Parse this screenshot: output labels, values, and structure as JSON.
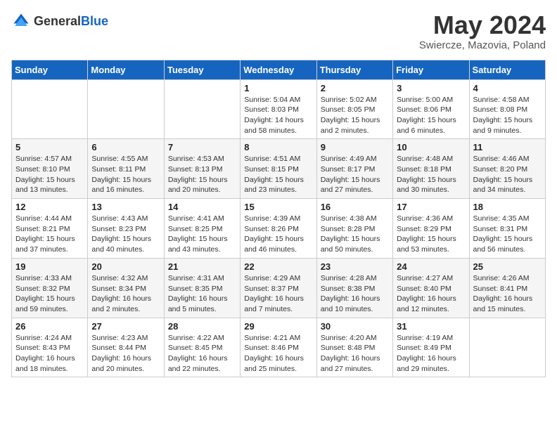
{
  "header": {
    "logo_general": "General",
    "logo_blue": "Blue",
    "month": "May 2024",
    "location": "Swiercze, Mazovia, Poland"
  },
  "weekdays": [
    "Sunday",
    "Monday",
    "Tuesday",
    "Wednesday",
    "Thursday",
    "Friday",
    "Saturday"
  ],
  "weeks": [
    [
      {
        "day": "",
        "sunrise": "",
        "sunset": "",
        "daylight": ""
      },
      {
        "day": "",
        "sunrise": "",
        "sunset": "",
        "daylight": ""
      },
      {
        "day": "",
        "sunrise": "",
        "sunset": "",
        "daylight": ""
      },
      {
        "day": "1",
        "sunrise": "Sunrise: 5:04 AM",
        "sunset": "Sunset: 8:03 PM",
        "daylight": "Daylight: 14 hours and 58 minutes."
      },
      {
        "day": "2",
        "sunrise": "Sunrise: 5:02 AM",
        "sunset": "Sunset: 8:05 PM",
        "daylight": "Daylight: 15 hours and 2 minutes."
      },
      {
        "day": "3",
        "sunrise": "Sunrise: 5:00 AM",
        "sunset": "Sunset: 8:06 PM",
        "daylight": "Daylight: 15 hours and 6 minutes."
      },
      {
        "day": "4",
        "sunrise": "Sunrise: 4:58 AM",
        "sunset": "Sunset: 8:08 PM",
        "daylight": "Daylight: 15 hours and 9 minutes."
      }
    ],
    [
      {
        "day": "5",
        "sunrise": "Sunrise: 4:57 AM",
        "sunset": "Sunset: 8:10 PM",
        "daylight": "Daylight: 15 hours and 13 minutes."
      },
      {
        "day": "6",
        "sunrise": "Sunrise: 4:55 AM",
        "sunset": "Sunset: 8:11 PM",
        "daylight": "Daylight: 15 hours and 16 minutes."
      },
      {
        "day": "7",
        "sunrise": "Sunrise: 4:53 AM",
        "sunset": "Sunset: 8:13 PM",
        "daylight": "Daylight: 15 hours and 20 minutes."
      },
      {
        "day": "8",
        "sunrise": "Sunrise: 4:51 AM",
        "sunset": "Sunset: 8:15 PM",
        "daylight": "Daylight: 15 hours and 23 minutes."
      },
      {
        "day": "9",
        "sunrise": "Sunrise: 4:49 AM",
        "sunset": "Sunset: 8:17 PM",
        "daylight": "Daylight: 15 hours and 27 minutes."
      },
      {
        "day": "10",
        "sunrise": "Sunrise: 4:48 AM",
        "sunset": "Sunset: 8:18 PM",
        "daylight": "Daylight: 15 hours and 30 minutes."
      },
      {
        "day": "11",
        "sunrise": "Sunrise: 4:46 AM",
        "sunset": "Sunset: 8:20 PM",
        "daylight": "Daylight: 15 hours and 34 minutes."
      }
    ],
    [
      {
        "day": "12",
        "sunrise": "Sunrise: 4:44 AM",
        "sunset": "Sunset: 8:21 PM",
        "daylight": "Daylight: 15 hours and 37 minutes."
      },
      {
        "day": "13",
        "sunrise": "Sunrise: 4:43 AM",
        "sunset": "Sunset: 8:23 PM",
        "daylight": "Daylight: 15 hours and 40 minutes."
      },
      {
        "day": "14",
        "sunrise": "Sunrise: 4:41 AM",
        "sunset": "Sunset: 8:25 PM",
        "daylight": "Daylight: 15 hours and 43 minutes."
      },
      {
        "day": "15",
        "sunrise": "Sunrise: 4:39 AM",
        "sunset": "Sunset: 8:26 PM",
        "daylight": "Daylight: 15 hours and 46 minutes."
      },
      {
        "day": "16",
        "sunrise": "Sunrise: 4:38 AM",
        "sunset": "Sunset: 8:28 PM",
        "daylight": "Daylight: 15 hours and 50 minutes."
      },
      {
        "day": "17",
        "sunrise": "Sunrise: 4:36 AM",
        "sunset": "Sunset: 8:29 PM",
        "daylight": "Daylight: 15 hours and 53 minutes."
      },
      {
        "day": "18",
        "sunrise": "Sunrise: 4:35 AM",
        "sunset": "Sunset: 8:31 PM",
        "daylight": "Daylight: 15 hours and 56 minutes."
      }
    ],
    [
      {
        "day": "19",
        "sunrise": "Sunrise: 4:33 AM",
        "sunset": "Sunset: 8:32 PM",
        "daylight": "Daylight: 15 hours and 59 minutes."
      },
      {
        "day": "20",
        "sunrise": "Sunrise: 4:32 AM",
        "sunset": "Sunset: 8:34 PM",
        "daylight": "Daylight: 16 hours and 2 minutes."
      },
      {
        "day": "21",
        "sunrise": "Sunrise: 4:31 AM",
        "sunset": "Sunset: 8:35 PM",
        "daylight": "Daylight: 16 hours and 5 minutes."
      },
      {
        "day": "22",
        "sunrise": "Sunrise: 4:29 AM",
        "sunset": "Sunset: 8:37 PM",
        "daylight": "Daylight: 16 hours and 7 minutes."
      },
      {
        "day": "23",
        "sunrise": "Sunrise: 4:28 AM",
        "sunset": "Sunset: 8:38 PM",
        "daylight": "Daylight: 16 hours and 10 minutes."
      },
      {
        "day": "24",
        "sunrise": "Sunrise: 4:27 AM",
        "sunset": "Sunset: 8:40 PM",
        "daylight": "Daylight: 16 hours and 12 minutes."
      },
      {
        "day": "25",
        "sunrise": "Sunrise: 4:26 AM",
        "sunset": "Sunset: 8:41 PM",
        "daylight": "Daylight: 16 hours and 15 minutes."
      }
    ],
    [
      {
        "day": "26",
        "sunrise": "Sunrise: 4:24 AM",
        "sunset": "Sunset: 8:43 PM",
        "daylight": "Daylight: 16 hours and 18 minutes."
      },
      {
        "day": "27",
        "sunrise": "Sunrise: 4:23 AM",
        "sunset": "Sunset: 8:44 PM",
        "daylight": "Daylight: 16 hours and 20 minutes."
      },
      {
        "day": "28",
        "sunrise": "Sunrise: 4:22 AM",
        "sunset": "Sunset: 8:45 PM",
        "daylight": "Daylight: 16 hours and 22 minutes."
      },
      {
        "day": "29",
        "sunrise": "Sunrise: 4:21 AM",
        "sunset": "Sunset: 8:46 PM",
        "daylight": "Daylight: 16 hours and 25 minutes."
      },
      {
        "day": "30",
        "sunrise": "Sunrise: 4:20 AM",
        "sunset": "Sunset: 8:48 PM",
        "daylight": "Daylight: 16 hours and 27 minutes."
      },
      {
        "day": "31",
        "sunrise": "Sunrise: 4:19 AM",
        "sunset": "Sunset: 8:49 PM",
        "daylight": "Daylight: 16 hours and 29 minutes."
      },
      {
        "day": "",
        "sunrise": "",
        "sunset": "",
        "daylight": ""
      }
    ]
  ]
}
